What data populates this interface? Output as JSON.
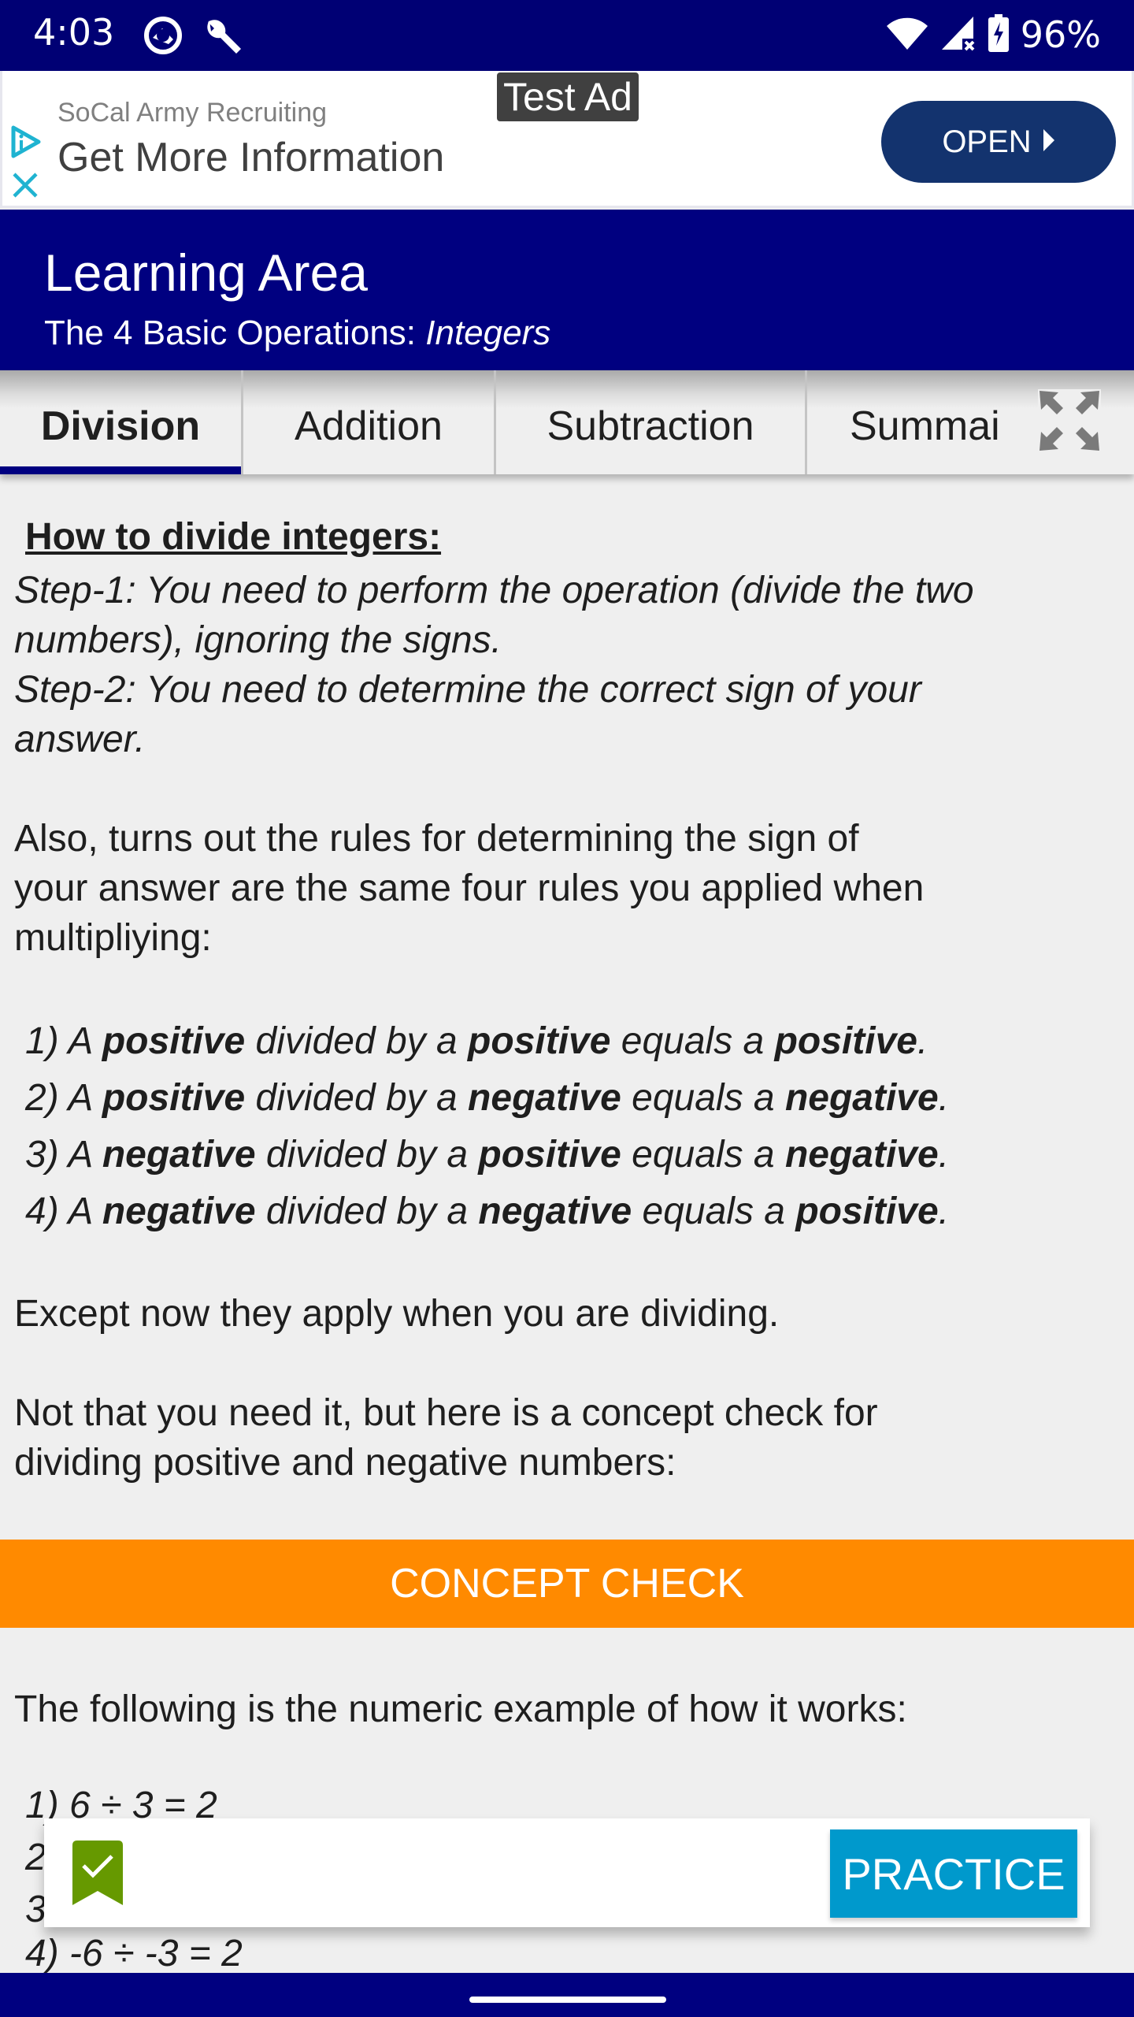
{
  "status_bar": {
    "time": "4:03",
    "battery_percent": "96%",
    "icons": [
      "data-saver-icon",
      "wrench-icon",
      "wifi-icon",
      "signal-no-service-icon",
      "battery-charging-icon"
    ]
  },
  "ad": {
    "label": "Test Ad",
    "sponsor": "SoCal Army Recruiting",
    "headline": "Get More Information",
    "cta": "OPEN",
    "colors": {
      "cta_bg": "#13336e",
      "adchoices": "#1fb3d1"
    }
  },
  "header": {
    "title": "Learning Area",
    "subtitle_prefix": "The 4 Basic Operations: ",
    "subtitle_emphasis": "Integers",
    "background": "#000080"
  },
  "tabs": [
    {
      "label": "Division",
      "active": true
    },
    {
      "label": "Addition",
      "active": false
    },
    {
      "label": "Subtraction",
      "active": false
    },
    {
      "label": "Summai",
      "active": false
    }
  ],
  "content": {
    "heading": "How to divide integers:",
    "step1_a": " Step-1: You need to perform the operation (divide the two",
    "step1_b": "numbers), ignoring the signs.",
    "step2_a": " Step-2: You need to determine the correct sign of your",
    "step2_b": "answer.",
    "also_a": " Also, turns out the rules for determining the sign of",
    "also_b": "your answer are the same four rules you applied when",
    "also_c": "multipliying:",
    "rules": [
      {
        "num": "1) A ",
        "first": "positive",
        "mid": " divided by a ",
        "second": "positive",
        "eq": " equals a ",
        "result": "positive",
        "end": "."
      },
      {
        "num": "2) A ",
        "first": "positive",
        "mid": " divided by a ",
        "second": "negative",
        "eq": " equals a ",
        "result": "negative",
        "end": "."
      },
      {
        "num": "3) A ",
        "first": "negative",
        "mid": " divided by a ",
        "second": "positive",
        "eq": " equals a ",
        "result": "negative",
        "end": "."
      },
      {
        "num": "4) A ",
        "first": "negative",
        "mid": " divided by a ",
        "second": "negative",
        "eq": " equals a ",
        "result": "positive",
        "end": "."
      }
    ],
    "except": " Except now they apply when you are dividing.",
    "not_that_a": " Not that you need it, but here is a concept check for",
    "not_that_b": "dividing positive and negative numbers:",
    "concept_check_label": "CONCEPT CHECK",
    "concept_check_color": "#ff8a00",
    "following": " The following is the numeric example of how it works:",
    "examples": [
      "1) 6 ÷ 3 = 2",
      "2",
      "3",
      "4) -6 ÷ -3 = 2"
    ]
  },
  "practice_card": {
    "button_label": "PRACTICE",
    "button_color": "#0099cc",
    "badge_color": "#669900"
  }
}
